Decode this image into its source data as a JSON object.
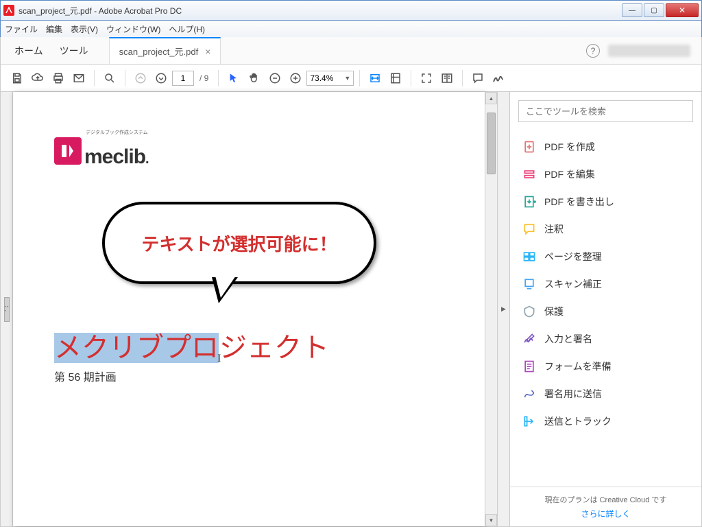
{
  "window": {
    "title": "scan_project_元.pdf - Adobe Acrobat Pro DC"
  },
  "menu": {
    "file": "ファイル",
    "edit": "編集",
    "view": "表示(V)",
    "window": "ウィンドウ(W)",
    "help": "ヘルプ(H)"
  },
  "tabstrip": {
    "home": "ホーム",
    "tools": "ツール",
    "tab1": "scan_project_元.pdf"
  },
  "toolbar": {
    "page_current": "1",
    "page_total": "/ 9",
    "zoom": "73.4%"
  },
  "doc": {
    "logo_sup": "デジタルブック作成システム",
    "logo_text": "meclib",
    "logo_dot": ".",
    "bubble": "テキストが選択可能に！",
    "title_sel": "メクリブプロ",
    "title_rest": "ジェクト",
    "subtitle": "第 56 期計画"
  },
  "sidebar": {
    "search_placeholder": "ここでツールを検索",
    "items": [
      {
        "label": "PDF を作成",
        "color": "#e57373"
      },
      {
        "label": "PDF を編集",
        "color": "#ec407a"
      },
      {
        "label": "PDF を書き出し",
        "color": "#26a69a"
      },
      {
        "label": "注釈",
        "color": "#fbc02d"
      },
      {
        "label": "ページを整理",
        "color": "#29b6f6"
      },
      {
        "label": "スキャン補正",
        "color": "#42a5f5"
      },
      {
        "label": "保護",
        "color": "#90a4ae"
      },
      {
        "label": "入力と署名",
        "color": "#7e57c2"
      },
      {
        "label": "フォームを準備",
        "color": "#ab47bc"
      },
      {
        "label": "署名用に送信",
        "color": "#5c6bc0"
      },
      {
        "label": "送信とトラック",
        "color": "#29b6f6"
      }
    ],
    "footer_text": "現在のプランは Creative Cloud です",
    "footer_link": "さらに詳しく"
  }
}
